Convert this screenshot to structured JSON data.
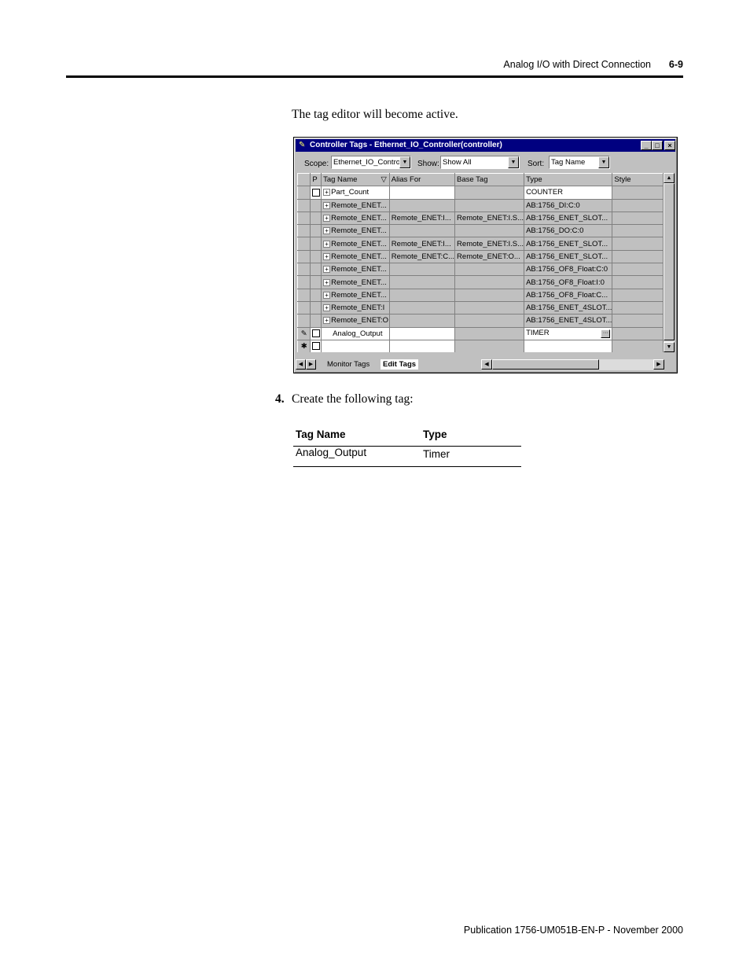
{
  "header": {
    "title": "Analog I/O with Direct Connection",
    "page_number": "6-9"
  },
  "intro_text": "The tag editor will become active.",
  "window": {
    "title": "Controller Tags - Ethernet_IO_Controller(controller)",
    "toolbar": {
      "scope_label": "Scope:",
      "scope_value": "Ethernet_IO_Control",
      "show_label": "Show:",
      "show_value": "Show All",
      "sort_label": "Sort:",
      "sort_value": "Tag Name"
    },
    "columns": [
      "P",
      "Tag Name",
      "Alias For",
      "Base Tag",
      "Type",
      "Style"
    ],
    "rows": [
      {
        "marker": "",
        "checkbox": true,
        "expand": true,
        "name": "Part_Count",
        "alias": "",
        "base": "",
        "type": "COUNTER",
        "style": "",
        "editable": true
      },
      {
        "marker": "",
        "checkbox": false,
        "expand": true,
        "name": "Remote_ENET...",
        "alias": "",
        "base": "",
        "type": "AB:1756_DI:C:0",
        "style": "",
        "editable": false
      },
      {
        "marker": "",
        "checkbox": false,
        "expand": true,
        "name": "Remote_ENET...",
        "alias": "Remote_ENET:I...",
        "base": "Remote_ENET:I.S...",
        "type": "AB:1756_ENET_SLOT...",
        "style": "",
        "editable": false
      },
      {
        "marker": "",
        "checkbox": false,
        "expand": true,
        "name": "Remote_ENET...",
        "alias": "",
        "base": "",
        "type": "AB:1756_DO:C:0",
        "style": "",
        "editable": false
      },
      {
        "marker": "",
        "checkbox": false,
        "expand": true,
        "name": "Remote_ENET...",
        "alias": "Remote_ENET:I...",
        "base": "Remote_ENET:I.S...",
        "type": "AB:1756_ENET_SLOT...",
        "style": "",
        "editable": false
      },
      {
        "marker": "",
        "checkbox": false,
        "expand": true,
        "name": "Remote_ENET...",
        "alias": "Remote_ENET:C...",
        "base": "Remote_ENET:O...",
        "type": "AB:1756_ENET_SLOT...",
        "style": "",
        "editable": false
      },
      {
        "marker": "",
        "checkbox": false,
        "expand": true,
        "name": "Remote_ENET...",
        "alias": "",
        "base": "",
        "type": "AB:1756_OF8_Float:C:0",
        "style": "",
        "editable": false
      },
      {
        "marker": "",
        "checkbox": false,
        "expand": true,
        "name": "Remote_ENET...",
        "alias": "",
        "base": "",
        "type": "AB:1756_OF8_Float:I:0",
        "style": "",
        "editable": false
      },
      {
        "marker": "",
        "checkbox": false,
        "expand": true,
        "name": "Remote_ENET...",
        "alias": "",
        "base": "",
        "type": "AB:1756_OF8_Float:C...",
        "style": "",
        "editable": false
      },
      {
        "marker": "",
        "checkbox": false,
        "expand": true,
        "name": "Remote_ENET:I",
        "alias": "",
        "base": "",
        "type": "AB:1756_ENET_4SLOT...",
        "style": "",
        "editable": false
      },
      {
        "marker": "",
        "checkbox": false,
        "expand": true,
        "name": "Remote_ENET:O",
        "alias": "",
        "base": "",
        "type": "AB:1756_ENET_4SLOT...",
        "style": "",
        "editable": false
      },
      {
        "marker": "✎",
        "checkbox": true,
        "expand": false,
        "name": "Analog_Output",
        "alias": "",
        "base": "",
        "type": "TIMER",
        "style": "",
        "editable": true,
        "ellipsis": true
      },
      {
        "marker": "✱",
        "checkbox": true,
        "expand": false,
        "name": "",
        "alias": "",
        "base": "",
        "type": "",
        "style": "",
        "editable": true
      }
    ],
    "tabs": {
      "monitor": "Monitor Tags",
      "edit": "Edit Tags"
    }
  },
  "step": {
    "number": "4.",
    "text": "Create the following tag:"
  },
  "spec_table": {
    "headers": [
      "Tag Name",
      "Type"
    ],
    "rows": [
      [
        "Analog_Output",
        "Timer"
      ]
    ]
  },
  "footer": "Publication 1756-UM051B-EN-P - November 2000"
}
